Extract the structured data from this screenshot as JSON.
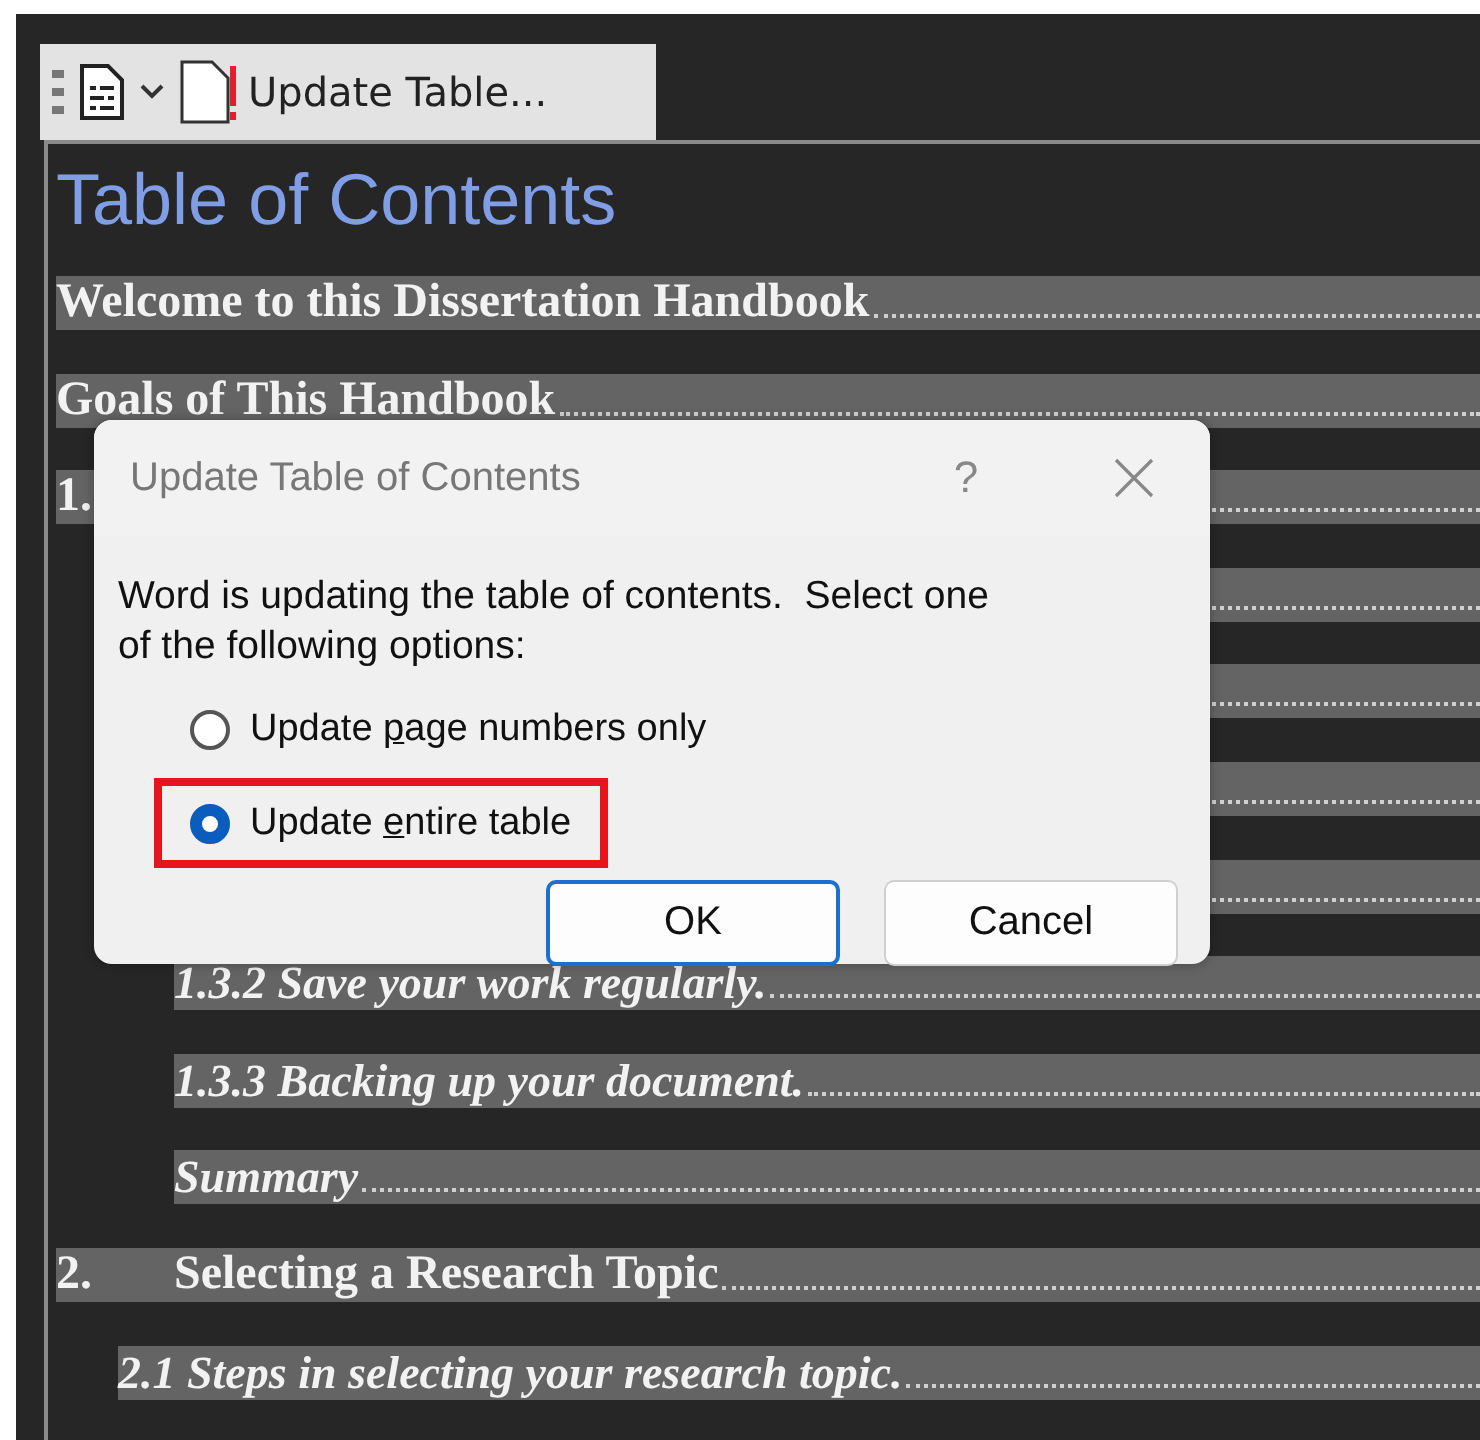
{
  "toolbar": {
    "button_label": "Update Table..."
  },
  "document": {
    "heading": "Table of Contents",
    "entries": [
      {
        "kind": "chapter",
        "text": "Welcome to this Dissertation Handbook"
      },
      {
        "kind": "chapter",
        "text": "Goals of This Handbook"
      },
      {
        "kind": "chapter",
        "number": "1."
      },
      {
        "kind": "section"
      },
      {
        "kind": "subsection"
      },
      {
        "kind": "subsection"
      },
      {
        "kind": "subsection"
      },
      {
        "kind": "subsection",
        "text": "1.3.2 Save your work regularly."
      },
      {
        "kind": "subsection",
        "text": "1.3.3 Backing up your document."
      },
      {
        "kind": "subsection",
        "text": "Summary"
      },
      {
        "kind": "chapter",
        "number": "2.",
        "text": "Selecting a Research Topic"
      },
      {
        "kind": "section",
        "text": "2.1 Steps in selecting your research topic."
      }
    ]
  },
  "dialog": {
    "title": "Update Table of Contents",
    "help": "?",
    "message": "Word is updating the table of contents.  Select one of the following options:",
    "options": [
      {
        "before": "Update ",
        "access_key": "p",
        "after": "age numbers only",
        "selected": false,
        "highlighted": false
      },
      {
        "before": "Update ",
        "access_key": "e",
        "after": "ntire table",
        "selected": true,
        "highlighted": true
      }
    ],
    "buttons": [
      {
        "label": "OK",
        "default": true
      },
      {
        "label": "Cancel",
        "default": false
      }
    ]
  }
}
